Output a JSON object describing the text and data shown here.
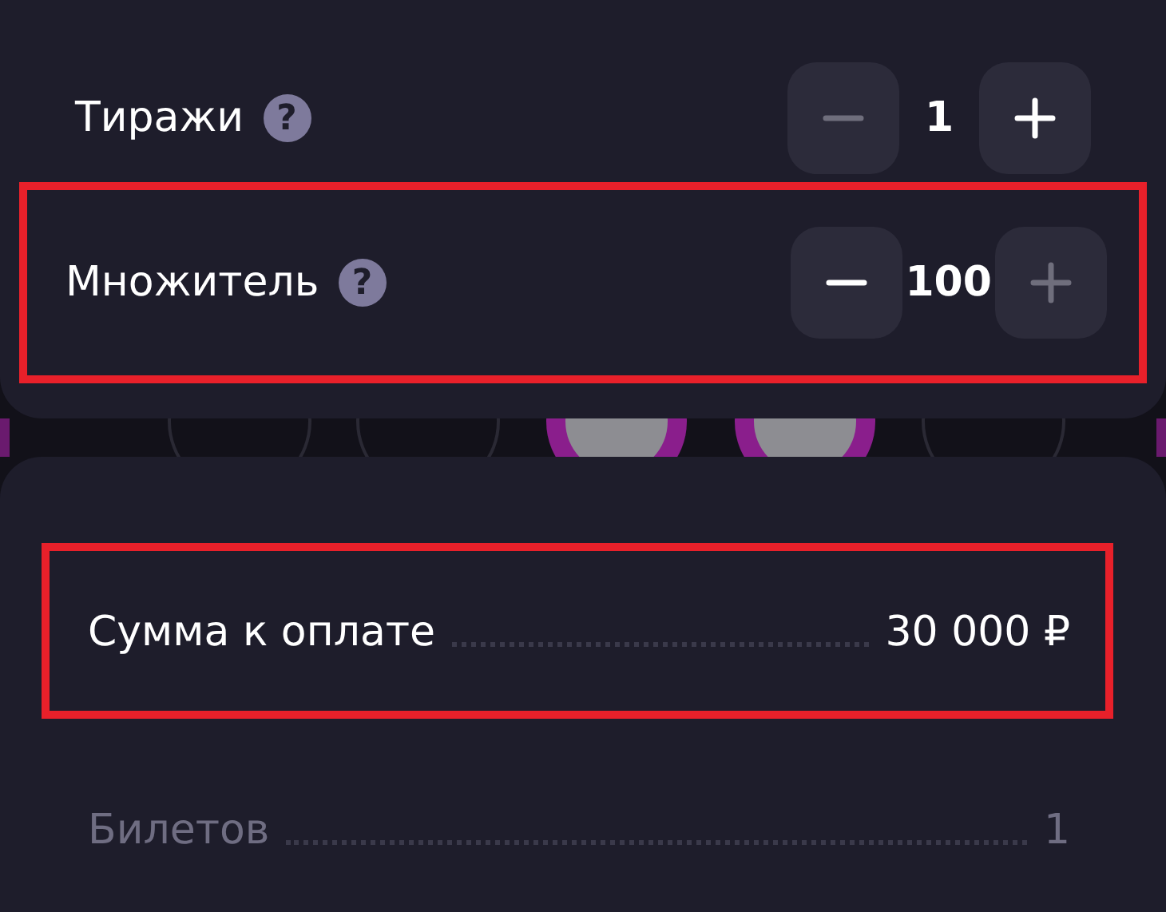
{
  "settings": [
    {
      "label": "Тиражи",
      "help": "?",
      "value": "1",
      "minus_disabled": true,
      "plus_disabled": false,
      "highlighted": false
    },
    {
      "label": "Множитель",
      "help": "?",
      "value": "100",
      "minus_disabled": false,
      "plus_disabled": true,
      "highlighted": true
    }
  ],
  "summary": [
    {
      "label": "Сумма к оплате",
      "value": "30 000 ₽",
      "muted": false,
      "highlighted": true
    },
    {
      "label": "Билетов",
      "value": "1",
      "muted": true,
      "highlighted": false
    }
  ]
}
